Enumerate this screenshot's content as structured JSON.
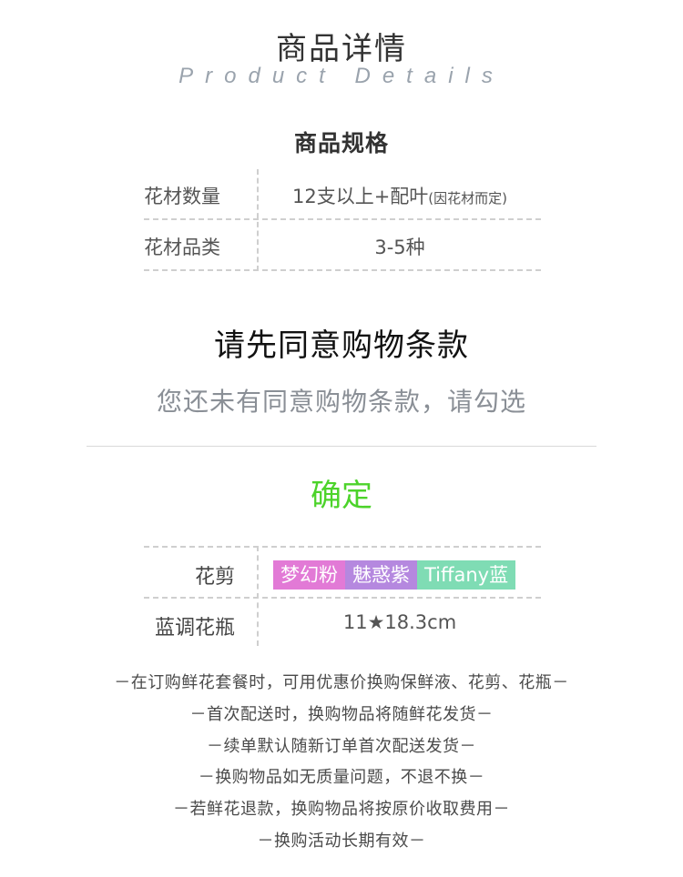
{
  "header": {
    "title_cn": "商品详情",
    "title_en": "Product Details"
  },
  "spec": {
    "title": "商品规格",
    "rows": [
      {
        "key": "花材数量",
        "value": "12支以上+配叶",
        "note": "(因花材而定)"
      },
      {
        "key": "花材品类",
        "value": "3-5种",
        "note": ""
      }
    ]
  },
  "modal": {
    "title": "请先同意购物条款",
    "message": "您还未有同意购物条款，请勾选",
    "confirm_label": "确定",
    "confirm_color": "#4cd32a"
  },
  "tools": {
    "rows": [
      {
        "key": "花剪",
        "chips": [
          {
            "label": "梦幻粉",
            "color": "#e27ad6"
          },
          {
            "label": "魅惑紫",
            "color": "#b588df"
          },
          {
            "label": "Tiffany蓝",
            "color": "#7fdcb4"
          }
        ]
      },
      {
        "key": "蓝调花瓶",
        "value": "11★18.3cm"
      }
    ]
  },
  "notes": [
    "－在订购鲜花套餐时，可用优惠价换购保鲜液、花剪、花瓶－",
    "－首次配送时，换购物品将随鲜花发货－",
    "－续单默认随新订单首次配送发货－",
    "－换购物品如无质量问题，不退不换－",
    "－若鲜花退款，换购物品将按原价收取费用－",
    "－换购活动长期有效－"
  ]
}
